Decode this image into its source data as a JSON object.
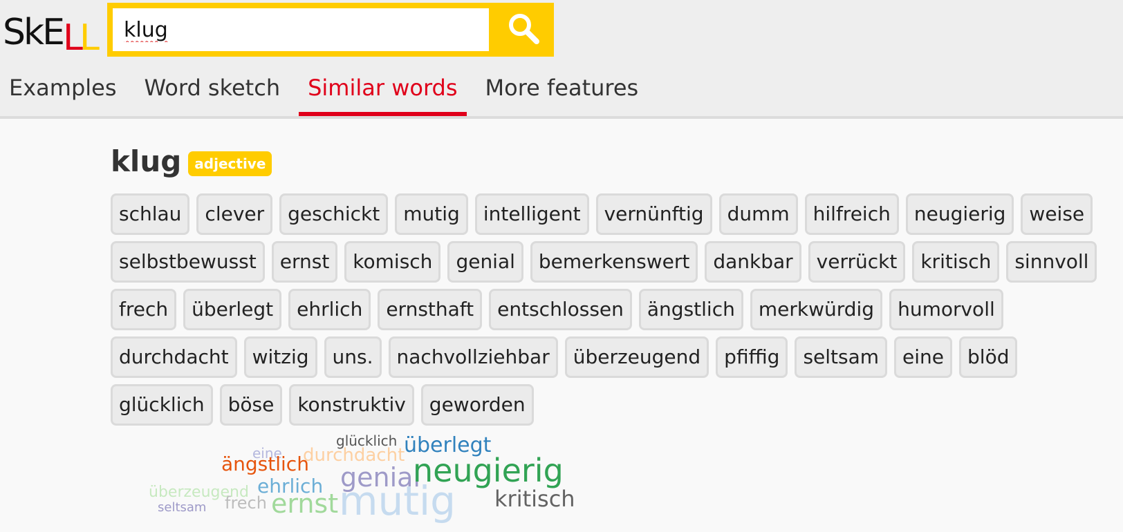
{
  "app": {
    "logo_text": "SkELL",
    "logo_parts": [
      "SkE",
      "L",
      "L"
    ]
  },
  "search": {
    "value": "klug",
    "button_icon": "search-icon",
    "accent_color": "#ffcc00"
  },
  "tabs": [
    {
      "label": "Examples",
      "active": false
    },
    {
      "label": "Word sketch",
      "active": false
    },
    {
      "label": "Similar words",
      "active": true
    },
    {
      "label": "More features",
      "active": false
    }
  ],
  "result": {
    "headword": "klug",
    "pos": "adjective",
    "similar_words": [
      "schlau",
      "clever",
      "geschickt",
      "mutig",
      "intelligent",
      "vernünftig",
      "dumm",
      "hilfreich",
      "neugierig",
      "weise",
      "selbstbewusst",
      "ernst",
      "komisch",
      "genial",
      "bemerkenswert",
      "dankbar",
      "verrückt",
      "kritisch",
      "sinnvoll",
      "frech",
      "überlegt",
      "ehrlich",
      "ernsthaft",
      "entschlossen",
      "ängstlich",
      "merkwürdig",
      "humorvoll",
      "durchdacht",
      "witzig",
      "uns.",
      "nachvollziehbar",
      "überzeugend",
      "pfiffig",
      "seltsam",
      "eine",
      "blöd",
      "glücklich",
      "böse",
      "konstruktiv",
      "geworden"
    ]
  },
  "word_cloud": [
    {
      "text": "glücklich",
      "color": "#555555"
    },
    {
      "text": "eine",
      "color": "#b5b8de"
    },
    {
      "text": "durchdacht",
      "color": "#fdd0a2"
    },
    {
      "text": "überlegt",
      "color": "#3182bd"
    },
    {
      "text": "ängstlich",
      "color": "#e6550d"
    },
    {
      "text": "genial",
      "color": "#9e9ac8"
    },
    {
      "text": "neugierig",
      "color": "#31a354"
    },
    {
      "text": "überzeugend",
      "color": "#c7e9c0"
    },
    {
      "text": "ehrlich",
      "color": "#6baed6"
    },
    {
      "text": "mutig",
      "color": "#c6dbef"
    },
    {
      "text": "kritisch",
      "color": "#636363"
    },
    {
      "text": "ernst",
      "color": "#a1d99b"
    },
    {
      "text": "frech",
      "color": "#bdbdbd"
    },
    {
      "text": "seltsam",
      "color": "#9e9ac8"
    }
  ]
}
